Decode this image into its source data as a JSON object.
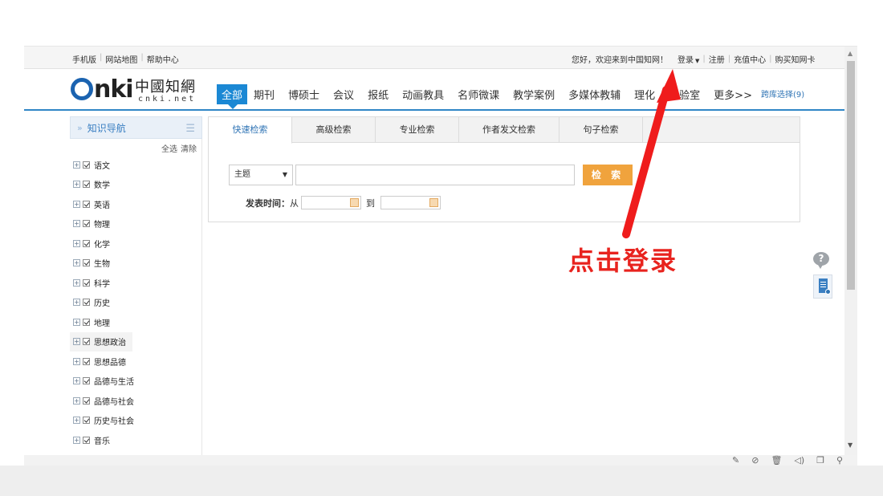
{
  "topbar": {
    "left_links": [
      "手机版",
      "网站地图",
      "帮助中心"
    ],
    "welcome": "您好，欢迎来到中国知网！",
    "login": "登录",
    "register": "注册",
    "recharge": "充值中心",
    "buy_card": "购买知网卡"
  },
  "logo": {
    "brand": "nki",
    "chinese": "中國知網",
    "domain": "cnki.net"
  },
  "nav": {
    "items": [
      "全部",
      "期刊",
      "博硕士",
      "会议",
      "报纸",
      "动画教具",
      "名师微课",
      "教学案例",
      "多媒体教辅",
      "理化",
      "实验室",
      "更多>>"
    ],
    "active_index": 0,
    "cross_db": "跨库选择(9)"
  },
  "sidebar": {
    "title": "知识导航",
    "select_all": "全选",
    "clear": "清除",
    "subjects": [
      "语文",
      "数学",
      "英语",
      "物理",
      "化学",
      "生物",
      "科学",
      "历史",
      "地理",
      "思想政治",
      "思想品德",
      "品德与生活",
      "品德与社会",
      "历史与社会",
      "音乐"
    ]
  },
  "search": {
    "tabs": [
      "快速检索",
      "高级检索",
      "专业检索",
      "作者发文检索",
      "句子检索"
    ],
    "active_tab": 0,
    "field_select": "主题",
    "query_value": "",
    "button": "检 索",
    "date_label": "发表时间：",
    "date_from": "从",
    "date_to": "到",
    "date_from_value": "",
    "date_to_value": ""
  },
  "annotation": {
    "text": "点击登录",
    "color": "#e8231e"
  },
  "icons": {
    "help": "help-bubble-icon",
    "doc": "document-icon",
    "bottom": [
      "pin-icon",
      "no-touch-icon",
      "trash-icon",
      "speaker-icon",
      "copy-icon",
      "search-icon"
    ]
  }
}
